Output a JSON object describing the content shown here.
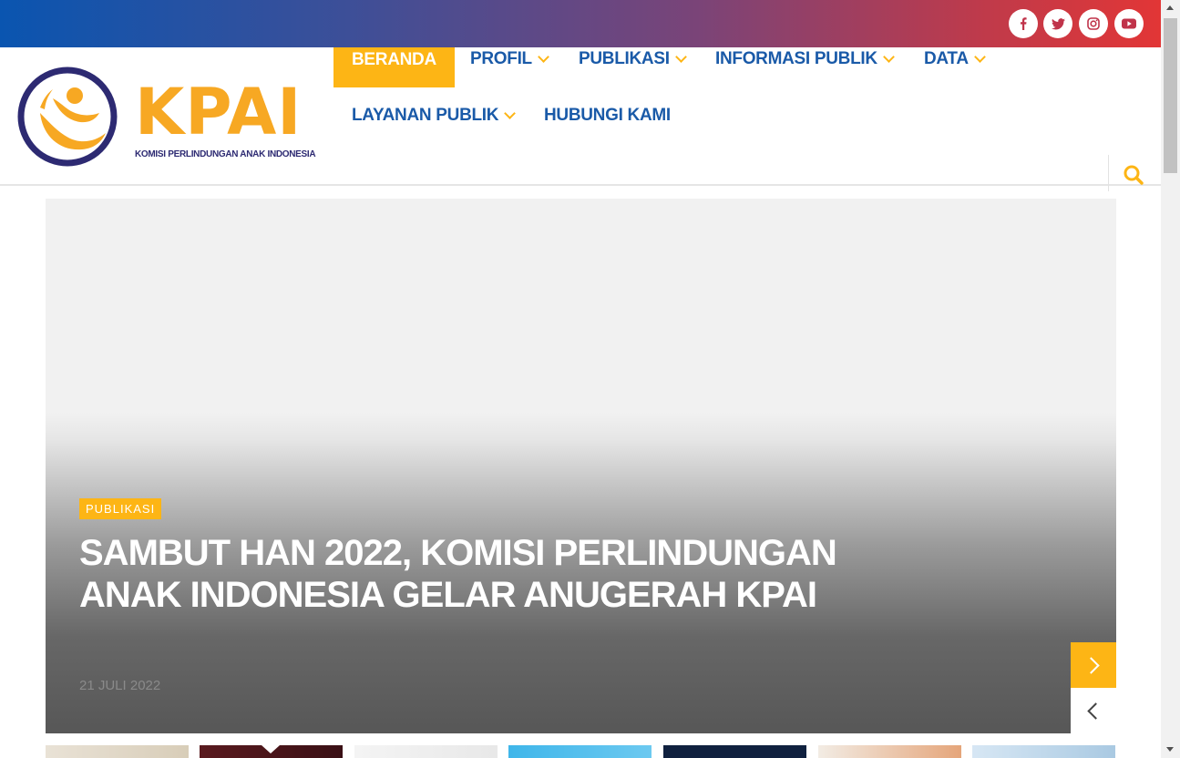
{
  "social": {
    "facebook_icon": "facebook-icon",
    "twitter_icon": "twitter-icon",
    "instagram_icon": "instagram-icon",
    "youtube_icon": "youtube-icon"
  },
  "logo": {
    "text": "KPAI",
    "subtitle": "KOMISI PERLINDUNGAN ANAK INDONESIA"
  },
  "nav": {
    "items": [
      {
        "label": "BERANDA"
      },
      {
        "label": "PROFIL"
      },
      {
        "label": "PUBLIKASI"
      },
      {
        "label": "INFORMASI PUBLIK"
      },
      {
        "label": "DATA"
      },
      {
        "label": "LAYANAN PUBLIK"
      },
      {
        "label": "HUBUNGI KAMI"
      }
    ]
  },
  "slider": {
    "category": "PUBLIKASI",
    "headline": "SAMBUT HAN 2022, KOMISI PERLINDUNGAN ANAK INDONESIA GELAR ANUGERAH KPAI",
    "date": "21 JULI 2022"
  },
  "colors": {
    "accent": "#fdb515",
    "nav_text": "#1a5aa8",
    "logo_purple": "#2d2a72",
    "logo_orange": "#f7a823"
  }
}
